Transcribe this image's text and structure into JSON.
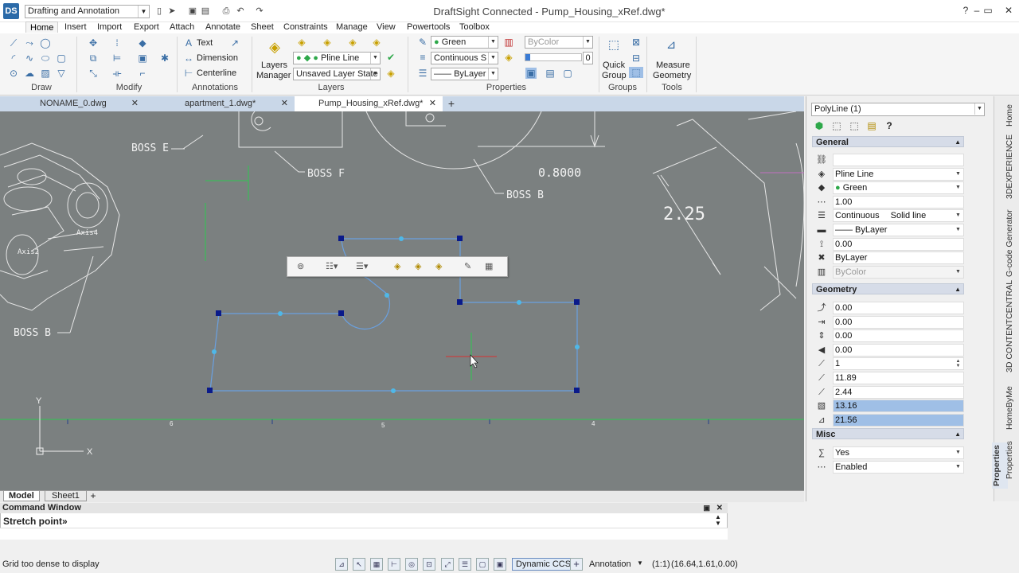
{
  "app": {
    "title": "DraftSight Connected - Pump_Housing_xRef.dwg*",
    "workspace": "Drafting and Annotation",
    "logo_text": "DS"
  },
  "window_buttons": {
    "help": "?",
    "minimize": "–",
    "restore": "▭",
    "close": "✕"
  },
  "menu": [
    "Home",
    "Insert",
    "Import",
    "Export",
    "Attach",
    "Annotate",
    "Sheet",
    "Constraints",
    "Manage",
    "View",
    "Powertools",
    "Toolbox"
  ],
  "ribbon": {
    "groups": {
      "draw": "Draw",
      "modify": "Modify",
      "annotations": "Annotations",
      "layers": "Layers",
      "properties": "Properties",
      "groups": "Groups",
      "tools": "Tools"
    },
    "annotations": {
      "text": "Text",
      "dimension": "Dimension",
      "centerline": "Centerline"
    },
    "layers": {
      "manager_line1": "Layers",
      "manager_line2": "Manager",
      "current_layer": "Pline Line",
      "layer_state": "Unsaved Layer State"
    },
    "properties": {
      "color": "Green",
      "linetype": "Continuous",
      "linetype_suffix": "S",
      "lineweight": "ByLayer",
      "transparency_color": "ByColor",
      "transparency_value": "0"
    },
    "groups_btn": {
      "line1": "Quick",
      "line2": "Group"
    },
    "tools_btn": {
      "line1": "Measure",
      "line2": "Geometry"
    }
  },
  "doc_tabs": [
    "NONAME_0.dwg",
    "apartment_1.dwg*",
    "Pump_Housing_xRef.dwg*"
  ],
  "active_tab": 2,
  "drawing": {
    "labels": {
      "boss_e": "BOSS E",
      "boss_f": "BOSS F",
      "boss_b_top": "BOSS B",
      "boss_b_left": "BOSS B",
      "dim_08": "0.8000",
      "dim_225": "2.25",
      "axis4": "Axis4",
      "axis2": "Axis2"
    },
    "ruler_ticks": [
      "6",
      "5",
      "4"
    ],
    "ucs": {
      "y": "Y",
      "x": "X"
    }
  },
  "model_tabs": [
    "Model",
    "Sheet1"
  ],
  "command": {
    "title": "Command Window",
    "prompt": "Stretch point»"
  },
  "status": {
    "message": "Grid too dense to display",
    "dynamic_ccs": "Dynamic CCS",
    "annotation": "Annotation",
    "scale": "(1:1)",
    "coords": "(16.64,1.61,0.00)"
  },
  "properties_panel": {
    "selection": "PolyLine (1)",
    "general_title": "General",
    "general": [
      {
        "icon": "link-icon",
        "value": ""
      },
      {
        "icon": "layer-icon",
        "value": "Pline Line",
        "dropdown": true
      },
      {
        "icon": "color-icon",
        "value": "Green",
        "dropdown": true,
        "swatch": "#2ea84a"
      },
      {
        "icon": "scale-icon",
        "value": "1.00"
      },
      {
        "icon": "linetype-icon",
        "value": "Continuous",
        "value2": "Solid line",
        "dropdown": true
      },
      {
        "icon": "lineweight-icon",
        "value": "—— ByLayer",
        "dropdown": true
      },
      {
        "icon": "thickness-icon",
        "value": "0.00"
      },
      {
        "icon": "plotstyle-icon",
        "value": "ByLayer"
      },
      {
        "icon": "transparency-icon",
        "value": "ByColor",
        "disabled": true,
        "dropdown": true
      }
    ],
    "geometry_title": "Geometry",
    "geometry": [
      {
        "icon": "vertex-icon",
        "value": "0.00"
      },
      {
        "icon": "vertex-x-icon",
        "value": "0.00"
      },
      {
        "icon": "vertex-y-icon",
        "value": "0.00"
      },
      {
        "icon": "start-width-icon",
        "value": "0.00"
      },
      {
        "icon": "end-width-icon",
        "value": "1",
        "stepper": true
      },
      {
        "icon": "global-width-icon",
        "value": "11.89"
      },
      {
        "icon": "elevation-icon",
        "value": "2.44"
      },
      {
        "icon": "area-icon",
        "value": "13.16",
        "selected": true
      },
      {
        "icon": "length-icon",
        "value": "21.56",
        "selected": true
      }
    ],
    "misc_title": "Misc",
    "misc": [
      {
        "icon": "closed-icon",
        "value": "Yes",
        "dropdown": true
      },
      {
        "icon": "linetype-gen-icon",
        "value": "Enabled",
        "dropdown": true
      }
    ]
  },
  "side_tabs": [
    "Home",
    "3DEXPERIENCE",
    "G-code Generator",
    "3D CONTENTCENTRAL",
    "HomeByMe",
    "Properties",
    "Properties"
  ]
}
